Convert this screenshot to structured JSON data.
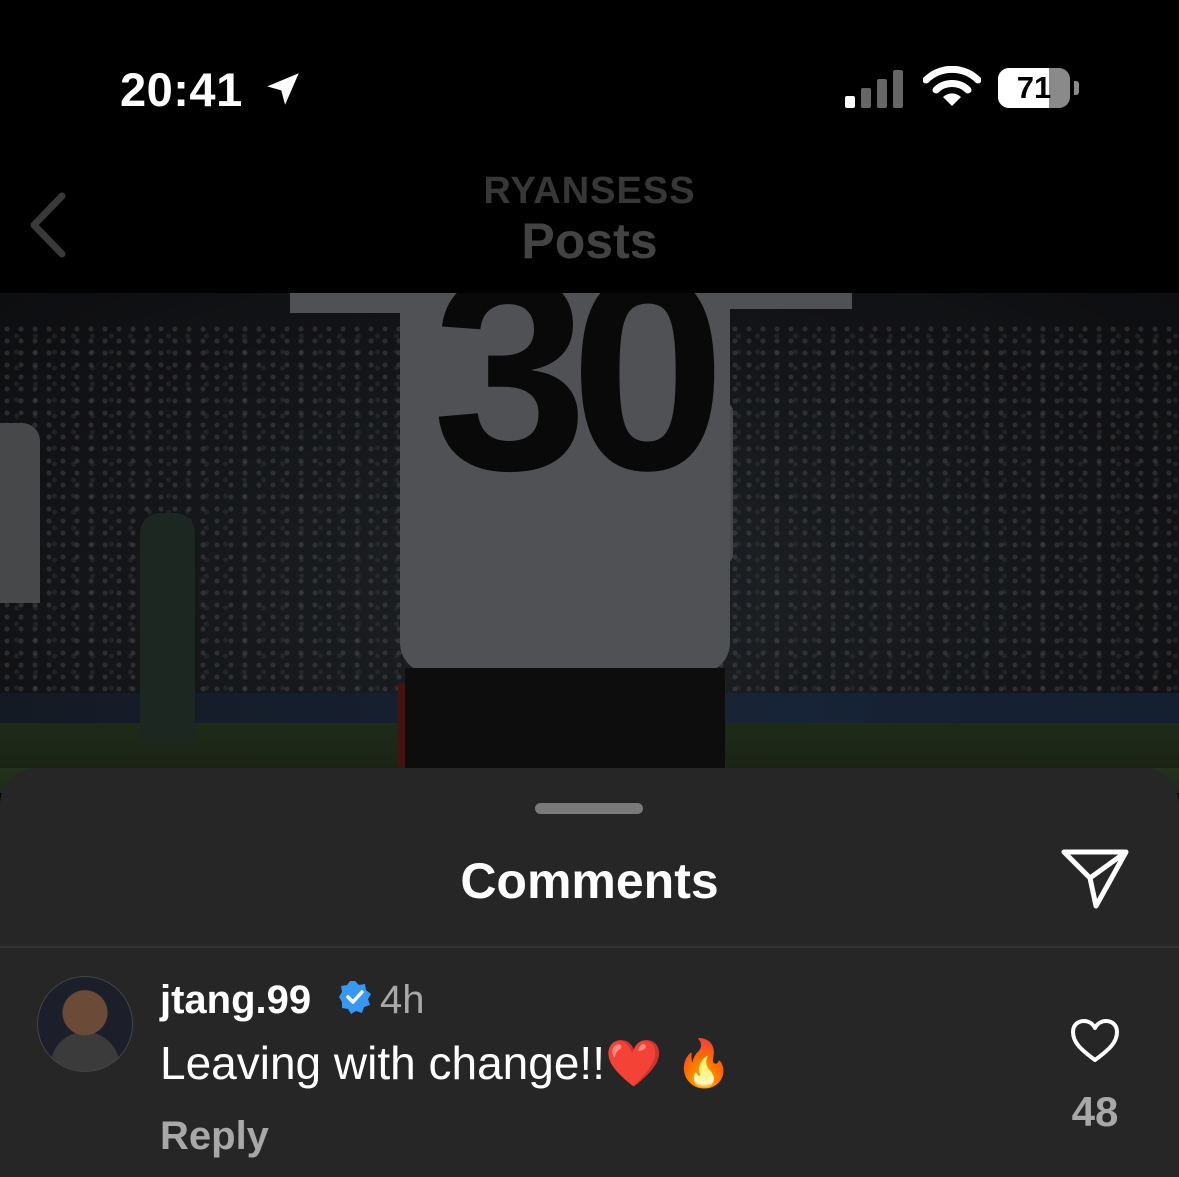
{
  "status_bar": {
    "time": "20:41",
    "battery_percent": 71,
    "battery_label": "71",
    "icons": [
      "location-arrow-icon",
      "cellular-signal-icon",
      "wifi-icon",
      "battery-icon"
    ]
  },
  "nav": {
    "subtitle": "RYANSESS",
    "title": "Posts",
    "back_icon": "chevron-left-icon"
  },
  "photo": {
    "shirt_number": "30"
  },
  "comments": {
    "title": "Comments",
    "share_icon": "paper-plane-icon",
    "items": [
      {
        "username": "jtang.99",
        "verified": true,
        "time": "4h",
        "text": "Leaving with change!!❤️ 🔥",
        "reply_label": "Reply",
        "likes": "48"
      }
    ]
  },
  "colors": {
    "background": "#000000",
    "sheet": "#262626",
    "secondary_text": "#a8a8a8",
    "verified_blue": "#3897f0"
  }
}
